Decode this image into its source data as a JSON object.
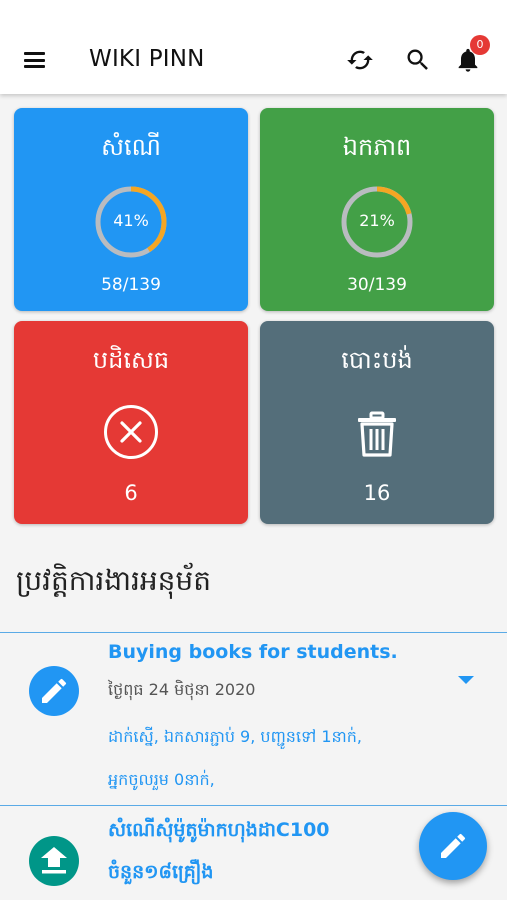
{
  "app": {
    "title": "WIKI PINN",
    "notification_count": "0"
  },
  "icons": {
    "menu": "menu-icon",
    "sync": "sync-icon",
    "search": "search-icon",
    "bell": "bell-icon",
    "cancel": "cancel-circle-icon",
    "trash": "trash-icon",
    "pencil": "pencil-icon",
    "upload": "upload-icon"
  },
  "colors": {
    "blue": "#2196f3",
    "green": "#43a047",
    "red": "#e53935",
    "slate": "#546e7a",
    "progress": "#f5a623",
    "teal": "#009688"
  },
  "cards": {
    "request": {
      "title": "សំណើ",
      "percent_label": "41%",
      "percent": 41,
      "value": "58/139"
    },
    "approved": {
      "title": "ឯកភាព",
      "percent_label": "21%",
      "percent": 21,
      "value": "30/139"
    },
    "rejected": {
      "title": "បដិសេធ",
      "value": "6"
    },
    "discarded": {
      "title": "បោះបង់",
      "value": "16"
    }
  },
  "history": {
    "title": "ប្រវត្តិការងារអនុម័ត",
    "items": [
      {
        "title": "Buying books for students.",
        "date": "ថ្ងៃពុធ 24 មិថុនា 2020",
        "line1": "ដាក់ស្នើ, ឯកសារភ្ជាប់ 9, បញ្ជូនទៅ 1នាក់,",
        "line2": "អ្នកចូលរួម 0នាក់,"
      },
      {
        "title": "សំណើសុំម៉ូតូម៉ាកហុងដាC100",
        "subtitle": "ចំនួន១៨គ្រឿង"
      }
    ]
  }
}
